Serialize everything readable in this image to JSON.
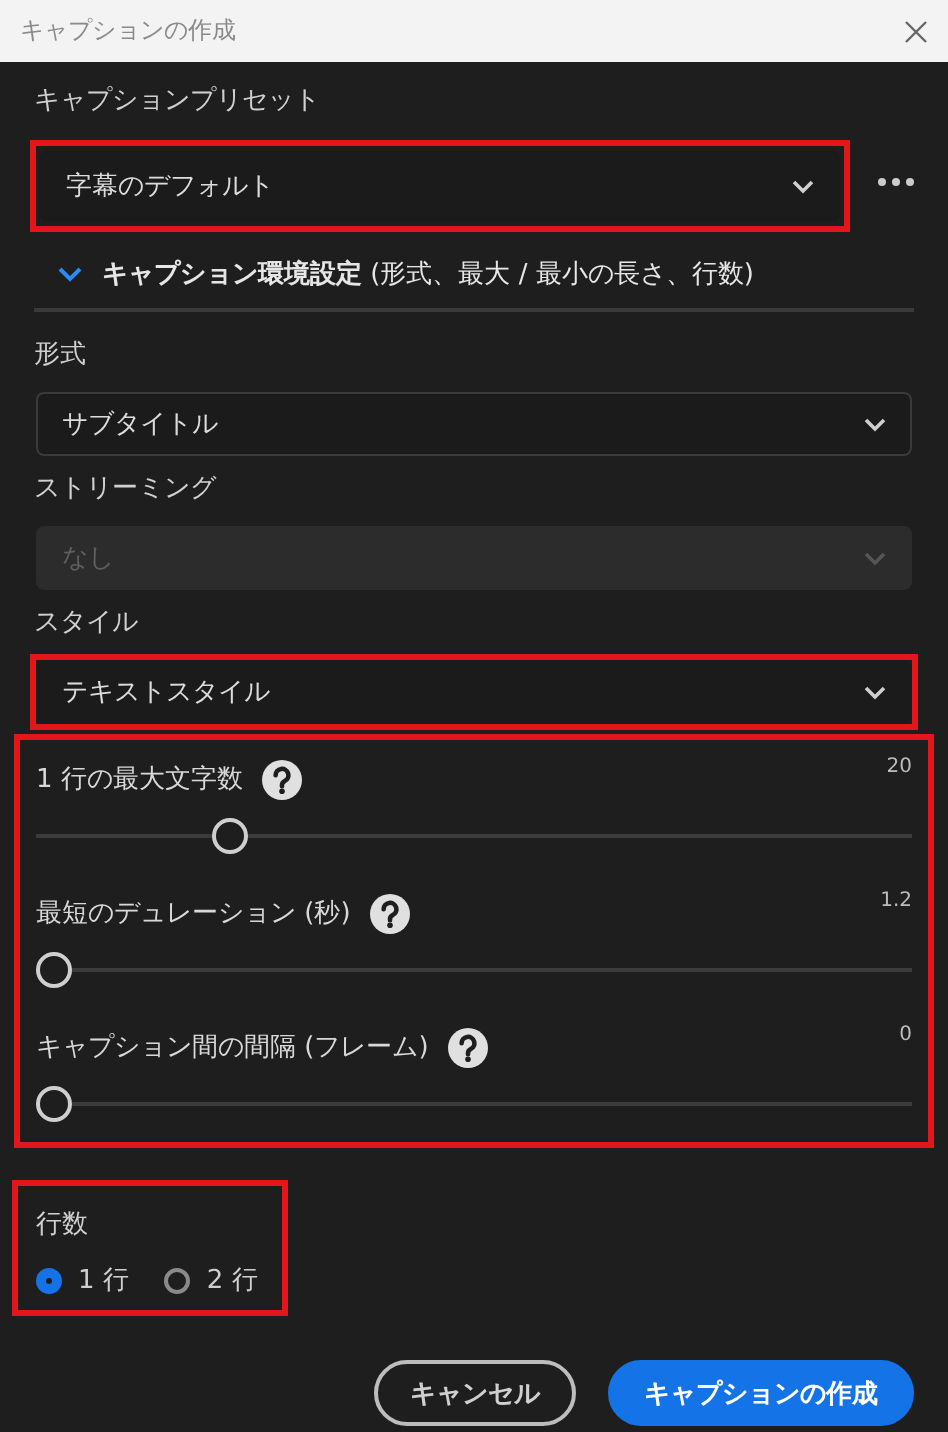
{
  "window": {
    "title": "キャプションの作成"
  },
  "preset": {
    "label": "キャプションプリセット",
    "value": "字幕のデフォルト",
    "highlighted": true
  },
  "settings_section": {
    "title": "**キャプション環境設定** (形式、最大 / 最小の長さ、行数)",
    "expanded": true
  },
  "fields": [
    {
      "label": "形式",
      "value": "サブタイトル",
      "disabled": false,
      "highlighted": false
    },
    {
      "label": "ストリーミング",
      "value": "なし",
      "disabled": true,
      "highlighted": false
    },
    {
      "label": "スタイル",
      "value": "テキストスタイル",
      "disabled": false,
      "highlighted": true
    }
  ],
  "sliders": {
    "highlighted": true,
    "items": [
      {
        "label": "1 行の最大文字数",
        "reading": "20",
        "level": 0.21
      },
      {
        "label": "最短のデュレーション (秒)",
        "reading": "1.2",
        "level": 0
      },
      {
        "label": "キャプション間の間隔 (フレーム)",
        "reading": "0",
        "level": 0
      }
    ]
  },
  "lines": {
    "label": "行数",
    "highlighted": true,
    "options": [
      {
        "label": "1 行",
        "selected": true
      },
      {
        "label": "2 行",
        "selected": false
      }
    ]
  },
  "buttons": [
    {
      "label": "キャンセル",
      "kind": "secondary"
    },
    {
      "label": "キャプションの作成",
      "kind": "primary"
    }
  ]
}
